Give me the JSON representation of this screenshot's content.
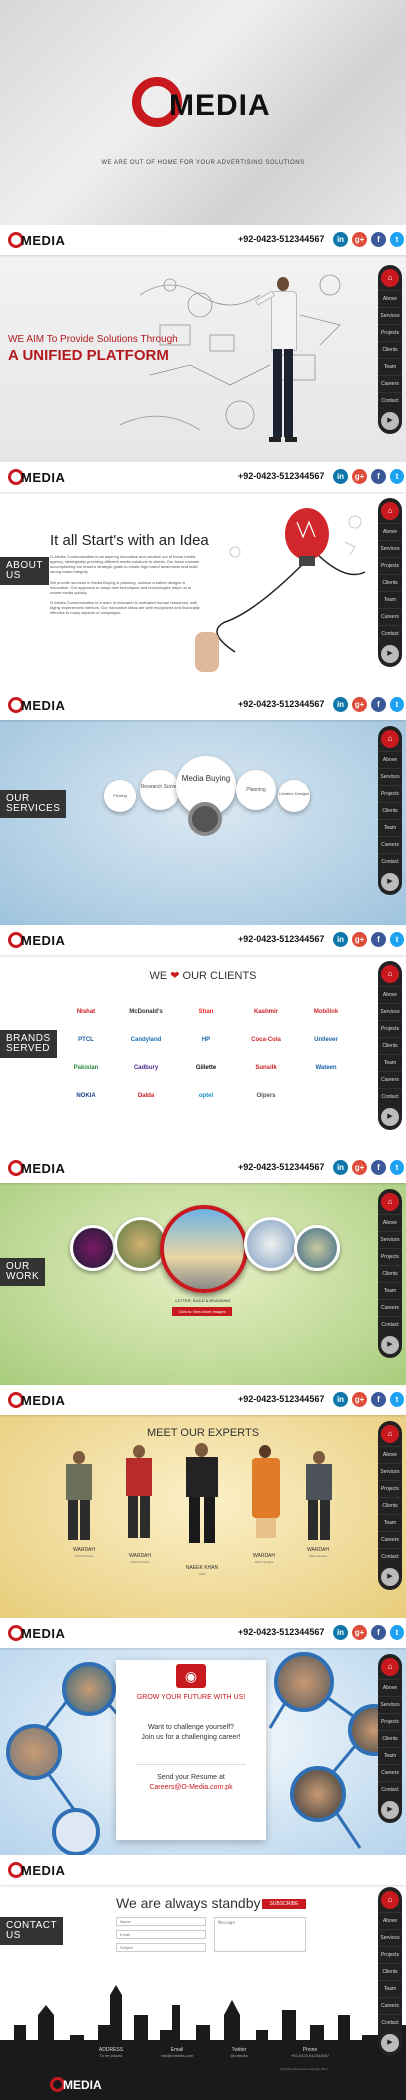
{
  "brand": {
    "logo": "MEDIA",
    "tagline": "WE ARE OUT OF HOME FOR YOUR ADVERTISING SOLUTIONS"
  },
  "header": {
    "phone": "+92-0423-512344567",
    "social": [
      "in",
      "g+",
      "f",
      "t"
    ]
  },
  "nav": {
    "items": [
      "Above",
      "Services",
      "Projects",
      "Clients",
      "Team",
      "Careers",
      "Contact"
    ]
  },
  "hero": {
    "line1": "WE AIM To Provide Solutions Through",
    "line2": "A UNIFIED PLATFORM"
  },
  "about": {
    "label_line1": "ABOUT",
    "label_line2": "US",
    "title": "It all Start's with an Idea",
    "paragraphs": [
      "O-Media Communication is an aspiring innovative and creative out of home media agency, strategically providing different media solutions to clients. Our focus towards accomplishing the brand's strategic goals to create high brand awareness and build strong brand integrity.",
      "We provide services in Media Buying & planning, outdoor creative designs & innovation. Our approach to adopt new techniques and technologies helps us to create media quickly.",
      "O-Media Communication is a team of educated & motivated human resources, with highly experienced mentors. Our innovative ideas are well recognized and financially effective to many aspects of campaigns."
    ]
  },
  "services": {
    "label_line1": "OUR",
    "label_line2": "SERVICES",
    "items": [
      "Printing",
      "Research Survey",
      "Media Buying",
      "Planning",
      "Creative Designs"
    ]
  },
  "brands": {
    "label_line1": "BRANDS",
    "label_line2": "SERVED",
    "title_pre": "WE",
    "title_post": "OUR  CLIENTS",
    "logos": [
      "Nishat",
      "McDonald's",
      "Shan",
      "Kashmir",
      "Mobilink",
      "PTCL",
      "Candyland",
      "HP",
      "Coca-Cola",
      "Unilever",
      "Pakistan",
      "Cadbury",
      "Gillette",
      "Sunsilk",
      "Wateen",
      "NOKIA",
      "Dalda",
      "optel",
      "Olpers"
    ]
  },
  "work": {
    "label_line1": "OUR",
    "label_line2": "WORK",
    "caption": "LETTER, BUILD & BRANDING",
    "button": "Click to View More Images"
  },
  "team": {
    "title": "MEET OUR EXPERTS",
    "members": [
      {
        "name": "WARDAH",
        "role": "Client Service"
      },
      {
        "name": "WARDAH",
        "role": "Client Service"
      },
      {
        "name": "NAEEK KHAN",
        "role": "CEO"
      },
      {
        "name": "WARDAH",
        "role": "Client Service"
      },
      {
        "name": "WARDAH",
        "role": "Client Service"
      }
    ]
  },
  "careers": {
    "title": "GROW YOUR FUTURE WITH US!",
    "line1": "Want to challenge yourself?",
    "line2": "Join us for a challenging career!",
    "line3": "Send your Resume at",
    "email": "Careers@O-Media.com.pk"
  },
  "contact": {
    "label_line1": "CONTACT",
    "label_line2": "US",
    "title": "We are always standby",
    "subscribe": "SUBSCRIBE",
    "name_ph": "Name",
    "email_ph": "Email",
    "subject_ph": "Subject",
    "message_ph": "Message",
    "footer": [
      {
        "label": "ADDRESS",
        "value": "To be placed"
      },
      {
        "label": "Email",
        "value": "info@omedia.com"
      },
      {
        "label": "Twitter",
        "value": "@omedia"
      },
      {
        "label": "Phone",
        "value": "+92-0423-512344567"
      }
    ],
    "copyright": "All Rights Reserved Copyright 2014"
  },
  "colors": {
    "accent": "#c8191e",
    "dark": "#222222"
  }
}
